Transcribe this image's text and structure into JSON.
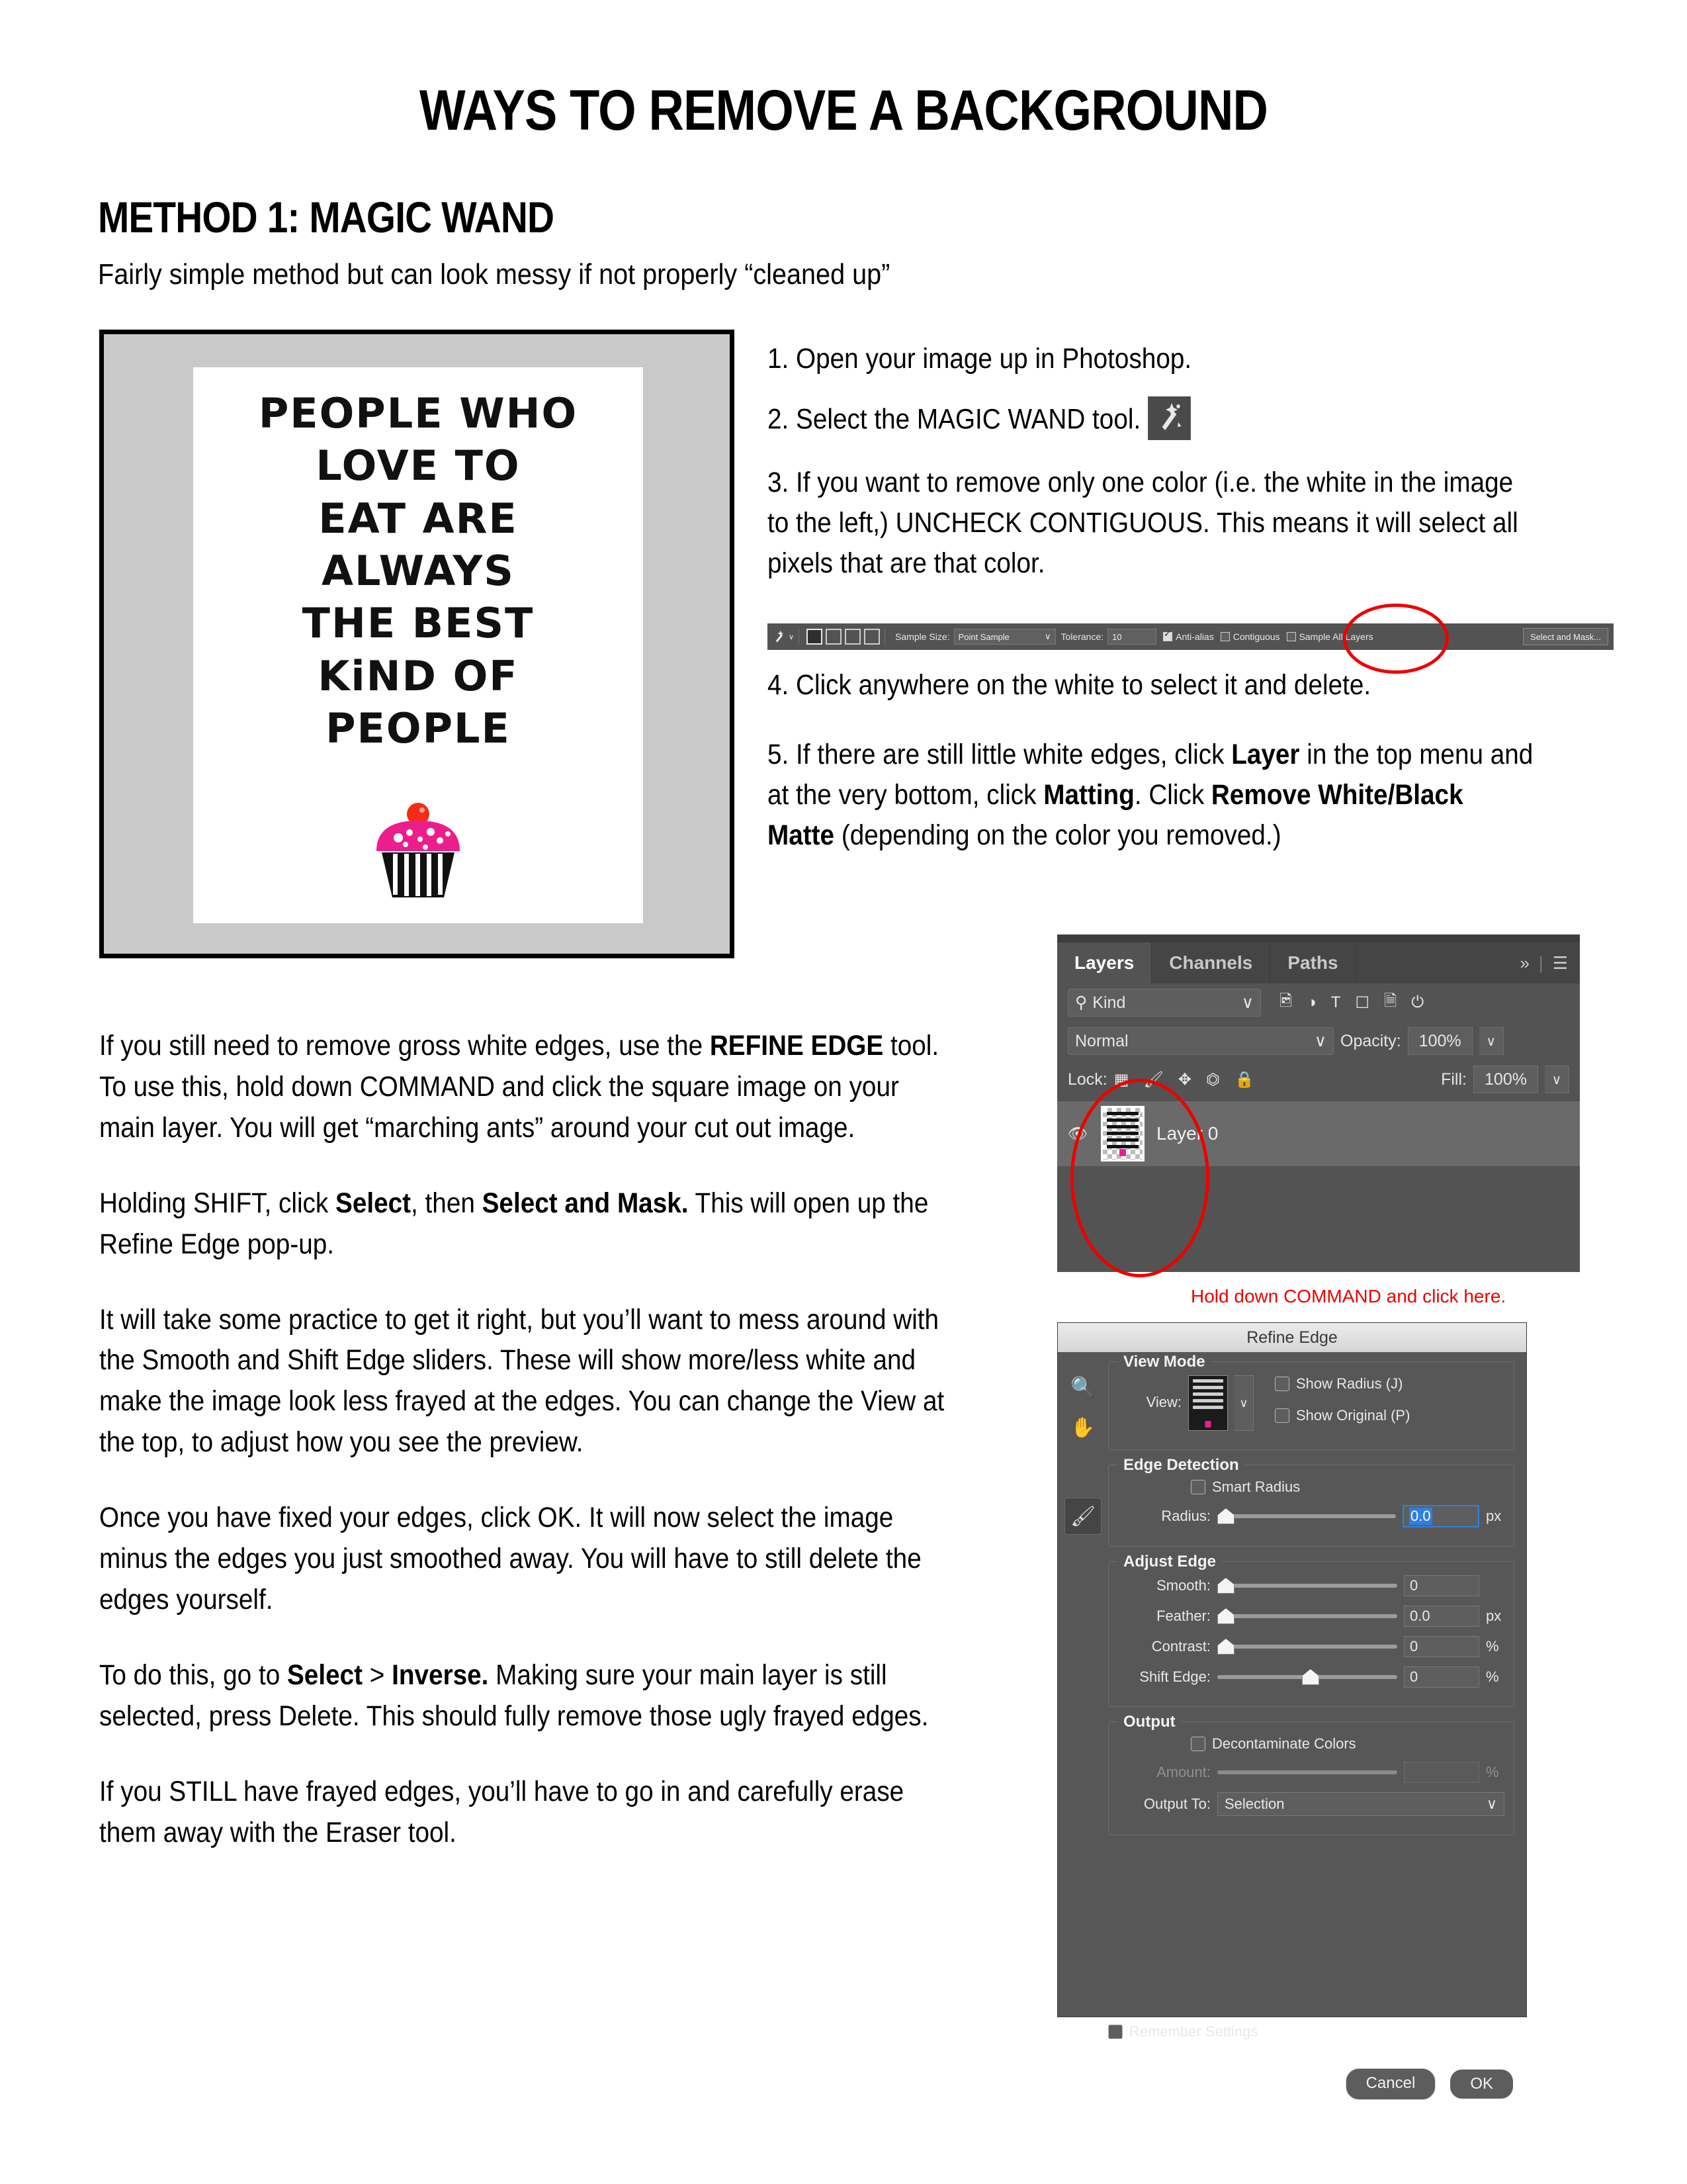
{
  "document": {
    "title": "WAYS TO REMOVE A BACKGROUND",
    "method_title": "METHOD 1: MAGIC WAND",
    "subtitle": "Fairly simple method but can look messy if not properly “cleaned up”"
  },
  "poster": {
    "lines": [
      "PEOPLE WHO",
      "LOVE TO",
      "EAT ARE",
      "ALWAYS",
      "THE BEST",
      "KiND OF",
      "PEOPLE"
    ],
    "frosting_color": "#ec1e8c",
    "cherry_color": "#f22c18",
    "wrapper_color": "#111111",
    "mat_color": "#c9c9c9",
    "border_color": "#000000"
  },
  "steps": [
    {
      "text": "1. Open your image up in Photoshop."
    },
    {
      "text": "2. Select the MAGIC WAND tool.",
      "has_tool_icon": true,
      "tool_icon": "magic-wand-icon"
    },
    {
      "text": "3. If you want to remove only one color (i.e. the white in the image to the left,) UNCHECK CONTIGUOUS. This means it will select all pixels that are that color."
    },
    {
      "text": "4. Click anywhere on the white to select it and delete."
    }
  ],
  "step5": {
    "prefix": "5. If there are still little white edges, click ",
    "bold1": "Layer",
    "mid1": " in the top menu and at the very bottom, click ",
    "bold2": "Matting",
    "mid2": ". Click ",
    "bold3": "Remove White/Black Matte",
    "suffix": " (depending on the color you removed.)"
  },
  "options_bar": {
    "tool_icon": "magic-wand-icon",
    "selection_modes": [
      "new-selection",
      "add-to-selection",
      "subtract-from-selection",
      "intersect-with-selection"
    ],
    "sample_size_label": "Sample Size:",
    "sample_size_value": "Point Sample",
    "tolerance_label": "Tolerance:",
    "tolerance_value": "10",
    "anti_alias_label": "Anti-alias",
    "anti_alias_checked": true,
    "contiguous_label": "Contiguous",
    "contiguous_checked": false,
    "sample_all_layers_label": "Sample All Layers",
    "sample_all_layers_checked": false,
    "select_and_mask_label": "Select and Mask...",
    "annotation_color": "#ee0000"
  },
  "body_paragraphs": [
    {
      "parts": [
        {
          "t": "If you still need to remove gross white edges, use the "
        },
        {
          "t": "REFINE EDGE",
          "b": true
        },
        {
          "t": " tool. To use this, hold down COMMAND and click the square image on your main layer. You will get “marching ants” around your cut out image."
        }
      ]
    },
    {
      "parts": [
        {
          "t": "Holding SHIFT, click "
        },
        {
          "t": "Select",
          "b": true
        },
        {
          "t": ", then "
        },
        {
          "t": "Select and Mask.",
          "b": true
        },
        {
          "t": " This will open up the Refine Edge pop-up."
        }
      ]
    },
    {
      "parts": [
        {
          "t": "It will take some practice to get it right, but you’ll want to mess around with the Smooth and Shift Edge sliders. These will show more/less white and make the image look less frayed at the edges. You can change the View at the top, to adjust how you see the preview."
        }
      ]
    },
    {
      "parts": [
        {
          "t": "Once you have fixed your edges, click OK. It will now select the image minus the edges you just smoothed away.  You will have to still delete the edges yourself."
        }
      ]
    },
    {
      "parts": [
        {
          "t": "To do this, go to "
        },
        {
          "t": "Select",
          "b": true
        },
        {
          "t": " > "
        },
        {
          "t": "Inverse.",
          "b": true
        },
        {
          "t": " Making sure your main layer is still selected, press Delete. This should fully remove those ugly frayed edges."
        }
      ]
    },
    {
      "parts": [
        {
          "t": "If you STILL have frayed edges, you’ll have to go in and carefully erase them away with the Eraser tool."
        }
      ]
    }
  ],
  "layers_panel": {
    "tabs": [
      {
        "label": "Layers",
        "active": true
      },
      {
        "label": "Channels",
        "active": false
      },
      {
        "label": "Paths",
        "active": false
      }
    ],
    "overflow_icon": "»",
    "menu_icon": "☰",
    "filter_label": "Kind",
    "filter_icon": "search-icon",
    "filter_caret": "∨",
    "filter_icons": [
      "pixel-layer-icon",
      "adjustment-layer-icon",
      "type-layer-icon",
      "shape-layer-icon",
      "smart-object-icon",
      "filter-toggle-icon"
    ],
    "blend_mode": "Normal",
    "blend_caret": "∨",
    "opacity_label": "Opacity:",
    "opacity_value": "100%",
    "lock_label": "Lock:",
    "lock_icons": [
      "lock-transparent-pixels-icon",
      "lock-image-pixels-icon",
      "lock-position-icon",
      "lock-artboard-icon",
      "lock-all-icon"
    ],
    "fill_label": "Fill:",
    "fill_value": "100%",
    "layer_name": "Layer 0",
    "eye_icon": "visibility-eye-icon",
    "annotation_caption": "Hold down COMMAND and click here.",
    "annotation_color": "#ee0000"
  },
  "refine_edge": {
    "title": "Refine Edge",
    "tools": [
      "zoom-tool-icon",
      "hand-tool-icon",
      "refine-radius-brush-icon"
    ],
    "view_mode": {
      "legend": "View Mode",
      "view_label": "View:",
      "view_caret": "∨",
      "show_radius_label": "Show Radius (J)",
      "show_radius_checked": false,
      "show_original_label": "Show Original (P)",
      "show_original_checked": false
    },
    "edge_detection": {
      "legend": "Edge Detection",
      "smart_radius_label": "Smart Radius",
      "smart_radius_checked": false,
      "radius_label": "Radius:",
      "radius_value": "0.0",
      "radius_unit": "px",
      "radius_pct": 0
    },
    "adjust_edge": {
      "legend": "Adjust Edge",
      "rows": [
        {
          "label": "Smooth:",
          "value": "0",
          "unit": "",
          "pct": 0
        },
        {
          "label": "Feather:",
          "value": "0.0",
          "unit": "px",
          "pct": 0
        },
        {
          "label": "Contrast:",
          "value": "0",
          "unit": "%",
          "pct": 0
        },
        {
          "label": "Shift Edge:",
          "value": "0",
          "unit": "%",
          "pct": 50
        }
      ]
    },
    "output": {
      "legend": "Output",
      "decontaminate_label": "Decontaminate Colors",
      "decontaminate_checked": false,
      "amount_label": "Amount:",
      "amount_value": "",
      "amount_unit": "%",
      "output_to_label": "Output To:",
      "output_to_value": "Selection",
      "output_caret": "∨"
    },
    "remember_label": "Remember Settings",
    "remember_checked": false,
    "cancel_label": "Cancel",
    "ok_label": "OK"
  }
}
